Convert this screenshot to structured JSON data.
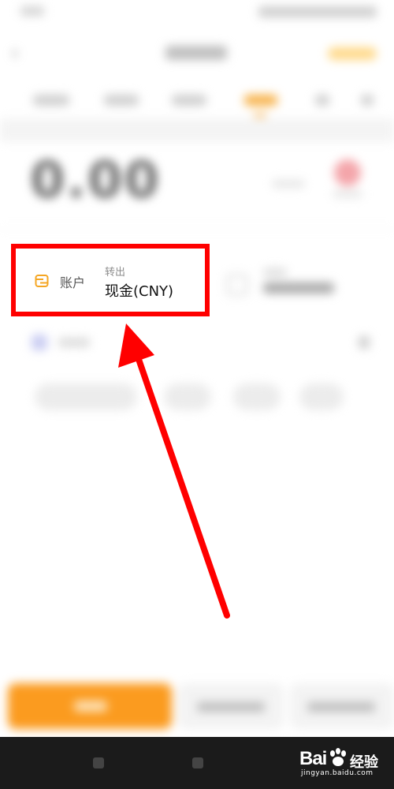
{
  "account_field": {
    "label": "账户",
    "sub_label": "转出",
    "value": "现金(CNY)",
    "icon": "wallet-icon"
  },
  "amount": {
    "value": "0.00"
  },
  "watermark": {
    "brand": "Bai",
    "brand_suffix": "经验",
    "url": "jingyan.baidu.com"
  },
  "colors": {
    "highlight_border": "#ff0000",
    "accent_orange": "#fb9b1f",
    "account_icon": "#f5a623"
  }
}
